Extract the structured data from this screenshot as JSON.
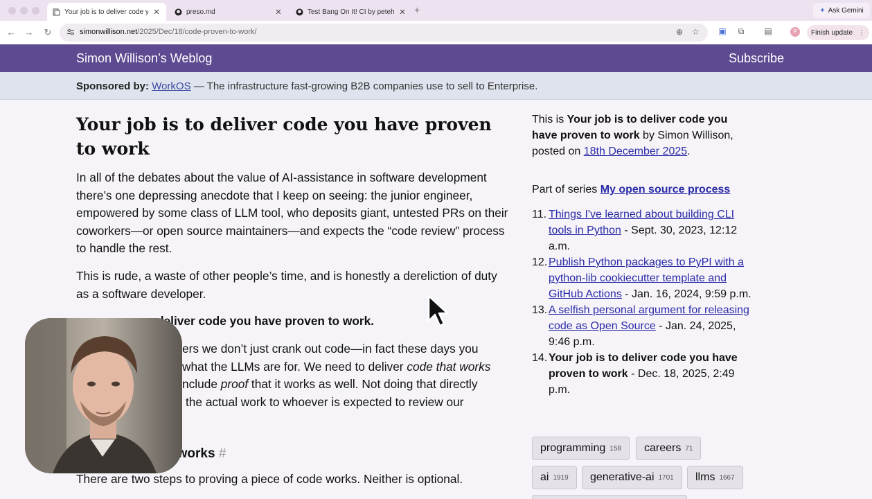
{
  "browser": {
    "tabs": [
      {
        "title": "Your job is to deliver code you have proven to work",
        "active": true,
        "icon": "document-icon"
      },
      {
        "title": "preso.md",
        "active": false,
        "icon": "github-icon"
      },
      {
        "title": "Test Bang On It! CI by petehu",
        "active": false,
        "icon": "github-icon"
      }
    ],
    "new_tab": "+",
    "ask_gemini": "Ask Gemini",
    "url_host": "simonwillison.net",
    "url_path": "/2025/Dec/18/code-proven-to-work/",
    "profile_initial": "P",
    "finish_update": "Finish update"
  },
  "site": {
    "title": "Simon Willison’s Weblog",
    "subscribe": "Subscribe",
    "accent": "#5d4a91"
  },
  "sponsor": {
    "label": "Sponsored by:",
    "link": "WorkOS",
    "text": " — The infrastructure fast-growing B2B companies use to sell to Enterprise."
  },
  "article": {
    "title": "Your job is to deliver code you have proven to work",
    "p1": "In all of the debates about the value of AI-assistance in software development there’s one depressing anecdote that I keep on seeing: the junior engineer, empowered by some class of LLM tool, who deposits giant, untested PRs on their coworkers—or open source maintainers—and expects the “code review” process to handle the rest.",
    "p2": "This is rude, a waste of other people’s time, and is honestly a dereliction of duty as a software developer.",
    "h3_visible": "deliver code you have proven to work.",
    "p3_line1": "ers we don’t just crank out code—in fact these days you",
    "p3_line2a": "what the LLMs are for. We need to deliver ",
    "p3_line2b": "code that works",
    "p3_line3a": "nclude ",
    "p3_line3b": "proof",
    "p3_line3c": " that it works as well. Not doing that directly",
    "p3_line4": "the actual work to whoever is expected to review our",
    "h2_visible": "t works",
    "h2_hash": "#",
    "p4": "There are two steps to proving a piece of code works. Neither is optional."
  },
  "sidebar": {
    "intro_pre": "This is ",
    "intro_title": "Your job is to deliver code you have proven to work",
    "intro_mid": " by Simon Willison, posted on ",
    "intro_date": "18th December 2025",
    "intro_end": ".",
    "series_pre": "Part of series ",
    "series_name": "My open source process",
    "series": [
      {
        "num": "11.",
        "title": "Things I've learned about building CLI tools in Python",
        "date": " - Sept. 30, 2023, 12:12 a.m.",
        "link": true
      },
      {
        "num": "12.",
        "title": "Publish Python packages to PyPI with a python-lib cookiecutter template and GitHub Actions",
        "date": " - Jan. 16, 2024, 9:59 p.m.",
        "link": true
      },
      {
        "num": "13.",
        "title": "A selfish personal argument for releasing code as Open Source",
        "date": " - Jan. 24, 2025, 9:46 p.m.",
        "link": true
      },
      {
        "num": "14.",
        "title": "Your job is to deliver code you have proven to work",
        "date": " - Dec. 18, 2025, 2:49 p.m.",
        "link": false
      }
    ],
    "tags": [
      {
        "name": "programming",
        "count": "158"
      },
      {
        "name": "careers",
        "count": "71"
      },
      {
        "name": "ai",
        "count": "1919"
      },
      {
        "name": "generative-ai",
        "count": "1701"
      },
      {
        "name": "llms",
        "count": "1667"
      }
    ]
  }
}
